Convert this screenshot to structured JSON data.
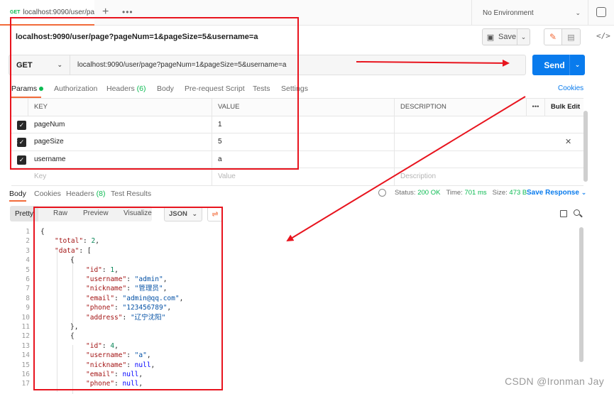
{
  "tab": {
    "method": "GET",
    "title": "localhost:9090/user/pa"
  },
  "environment": {
    "label": "No Environment"
  },
  "request": {
    "name": "localhost:9090/user/page?pageNum=1&pageSize=5&username=a",
    "method": "GET",
    "url": "localhost:9090/user/page?pageNum=1&pageSize=5&username=a",
    "save_label": "Save",
    "send_label": "Send"
  },
  "request_tabs": {
    "params": "Params",
    "authorization": "Authorization",
    "headers": "Headers",
    "headers_count": "(6)",
    "body": "Body",
    "prerequest": "Pre-request Script",
    "tests": "Tests",
    "settings": "Settings",
    "cookies": "Cookies"
  },
  "params_table": {
    "headers": {
      "key": "KEY",
      "value": "VALUE",
      "description": "DESCRIPTION",
      "more": "•••",
      "bulk_edit": "Bulk Edit"
    },
    "rows": [
      {
        "key": "pageNum",
        "value": "1"
      },
      {
        "key": "pageSize",
        "value": "5"
      },
      {
        "key": "username",
        "value": "a"
      }
    ],
    "placeholder": {
      "key": "Key",
      "value": "Value",
      "description": "Description"
    }
  },
  "response_tabs": {
    "body": "Body",
    "cookies": "Cookies",
    "headers": "Headers",
    "headers_count": "(8)",
    "test_results": "Test Results"
  },
  "response_status": {
    "status_label": "Status:",
    "status": "200 OK",
    "time_label": "Time:",
    "time": "701 ms",
    "size_label": "Size:",
    "size": "473 B",
    "save_response": "Save Response"
  },
  "view_modes": {
    "pretty": "Pretty",
    "raw": "Raw",
    "preview": "Preview",
    "visualize": "Visualize",
    "format": "JSON"
  },
  "json_lines": [
    "{",
    "\"total\": 2,",
    "\"data\": [",
    "{",
    "\"id\": 1,",
    "\"username\": \"admin\",",
    "\"nickname\": \"管理员\",",
    "\"email\": \"admin@qq.com\",",
    "\"phone\": \"123456789\",",
    "\"address\": \"辽宁沈阳\"",
    "},",
    "{",
    "\"id\": 4,",
    "\"username\": \"a\",",
    "\"nickname\": null,",
    "\"email\": null,",
    "\"phone\": null,"
  ],
  "watermark": "CSDN @Ironman Jay",
  "colors": {
    "accent": "#f26b3a",
    "send": "#097bed",
    "status_ok": "#0cbb52",
    "annotation": "#e8141e"
  },
  "icons": [
    "plus-icon",
    "more-icon",
    "chevron-down-icon",
    "eye-icon",
    "save-icon",
    "pencil-icon",
    "comment-icon",
    "code-icon",
    "close-icon",
    "globe-icon",
    "wrap-icon",
    "copy-icon",
    "search-icon",
    "checkbox-icon"
  ]
}
